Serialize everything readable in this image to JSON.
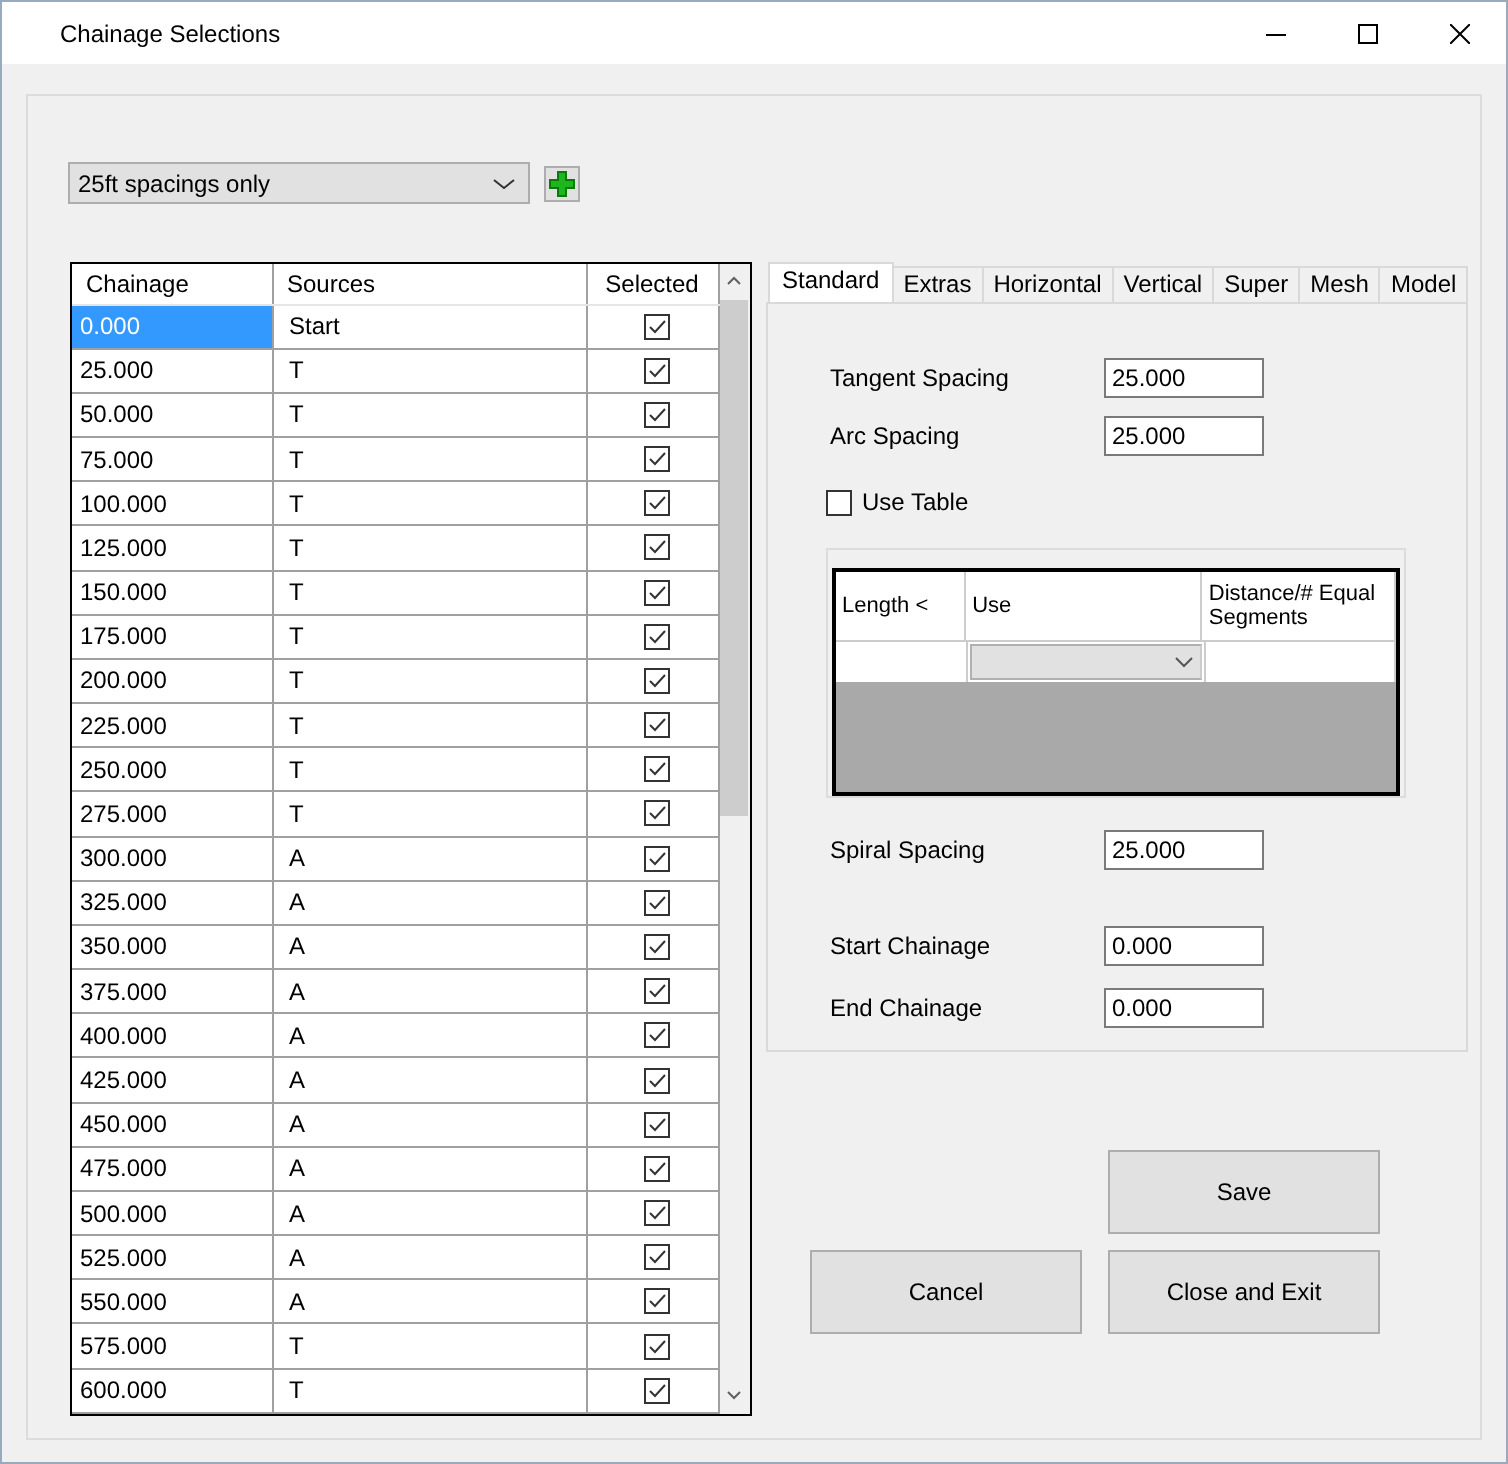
{
  "window": {
    "title": "Chainage Selections"
  },
  "preset_dropdown": {
    "value": "25ft spacings only"
  },
  "chainage_grid": {
    "columns": [
      "Chainage",
      "Sources",
      "Selected"
    ],
    "rows": [
      {
        "chainage": "0.000",
        "source": "Start",
        "checked": true,
        "selected": true
      },
      {
        "chainage": "25.000",
        "source": "T",
        "checked": true,
        "selected": false
      },
      {
        "chainage": "50.000",
        "source": "T",
        "checked": true,
        "selected": false
      },
      {
        "chainage": "75.000",
        "source": "T",
        "checked": true,
        "selected": false
      },
      {
        "chainage": "100.000",
        "source": "T",
        "checked": true,
        "selected": false
      },
      {
        "chainage": "125.000",
        "source": "T",
        "checked": true,
        "selected": false
      },
      {
        "chainage": "150.000",
        "source": "T",
        "checked": true,
        "selected": false
      },
      {
        "chainage": "175.000",
        "source": "T",
        "checked": true,
        "selected": false
      },
      {
        "chainage": "200.000",
        "source": "T",
        "checked": true,
        "selected": false
      },
      {
        "chainage": "225.000",
        "source": "T",
        "checked": true,
        "selected": false
      },
      {
        "chainage": "250.000",
        "source": "T",
        "checked": true,
        "selected": false
      },
      {
        "chainage": "275.000",
        "source": "T",
        "checked": true,
        "selected": false
      },
      {
        "chainage": "300.000",
        "source": "A",
        "checked": true,
        "selected": false
      },
      {
        "chainage": "325.000",
        "source": "A",
        "checked": true,
        "selected": false
      },
      {
        "chainage": "350.000",
        "source": "A",
        "checked": true,
        "selected": false
      },
      {
        "chainage": "375.000",
        "source": "A",
        "checked": true,
        "selected": false
      },
      {
        "chainage": "400.000",
        "source": "A",
        "checked": true,
        "selected": false
      },
      {
        "chainage": "425.000",
        "source": "A",
        "checked": true,
        "selected": false
      },
      {
        "chainage": "450.000",
        "source": "A",
        "checked": true,
        "selected": false
      },
      {
        "chainage": "475.000",
        "source": "A",
        "checked": true,
        "selected": false
      },
      {
        "chainage": "500.000",
        "source": "A",
        "checked": true,
        "selected": false
      },
      {
        "chainage": "525.000",
        "source": "A",
        "checked": true,
        "selected": false
      },
      {
        "chainage": "550.000",
        "source": "A",
        "checked": true,
        "selected": false
      },
      {
        "chainage": "575.000",
        "source": "T",
        "checked": true,
        "selected": false
      },
      {
        "chainage": "600.000",
        "source": "T",
        "checked": true,
        "selected": false
      }
    ]
  },
  "tabs": [
    {
      "label": "Standard",
      "selected": true
    },
    {
      "label": "Extras",
      "selected": false
    },
    {
      "label": "Horizontal",
      "selected": false
    },
    {
      "label": "Vertical",
      "selected": false
    },
    {
      "label": "Super",
      "selected": false
    },
    {
      "label": "Mesh",
      "selected": false
    },
    {
      "label": "Model",
      "selected": false
    }
  ],
  "standard_tab": {
    "tangent_spacing": {
      "label": "Tangent Spacing",
      "value": "25.000"
    },
    "arc_spacing": {
      "label": "Arc Spacing",
      "value": "25.000"
    },
    "use_table": {
      "label": "Use Table",
      "checked": false
    },
    "spacing_table": {
      "columns": [
        "Length <",
        "Use",
        "Distance/# Equal Segments"
      ]
    },
    "spiral_spacing": {
      "label": "Spiral Spacing",
      "value": "25.000"
    },
    "start_chainage": {
      "label": "Start Chainage",
      "value": "0.000"
    },
    "end_chainage": {
      "label": "End Chainage",
      "value": "0.000"
    }
  },
  "buttons": [
    "Save",
    "Cancel",
    "Close and Exit"
  ]
}
